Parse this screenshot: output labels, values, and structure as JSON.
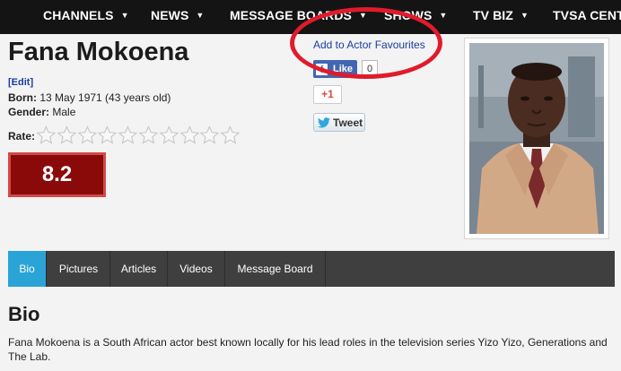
{
  "nav": {
    "items": [
      {
        "label": "CHANNELS"
      },
      {
        "label": "NEWS"
      },
      {
        "label": "MESSAGE BOARDS"
      },
      {
        "label": "SHOWS"
      },
      {
        "label": "TV BIZ"
      },
      {
        "label": "TVSA CENTR"
      }
    ]
  },
  "actor": {
    "name": "Fana Mokoena",
    "edit_label": "[Edit]",
    "born_label": "Born:",
    "born_value": "13 May 1971 (43 years old)",
    "gender_label": "Gender:",
    "gender_value": "Male",
    "rate_label": "Rate:",
    "rating_stars_filled": 0,
    "rating_stars_total": 10,
    "score": "8.2"
  },
  "social": {
    "favourites_link": "Add to Actor Favourites",
    "fb_like_label": "Like",
    "fb_count": "0",
    "gplus_label": "+1",
    "tweet_label": "Tweet"
  },
  "tabs": [
    {
      "label": "Bio",
      "active": true
    },
    {
      "label": "Pictures"
    },
    {
      "label": "Articles"
    },
    {
      "label": "Videos"
    },
    {
      "label": "Message Board"
    }
  ],
  "bio": {
    "heading": "Bio",
    "text": "Fana Mokoena is a South African actor best known locally for his lead roles in the television series Yizo Yizo, Generations and The Lab."
  },
  "colors": {
    "nav_bg": "#141414",
    "score_bg": "#8a0a0a",
    "active_tab": "#2aa4d6",
    "annotation": "#e01b2c"
  }
}
